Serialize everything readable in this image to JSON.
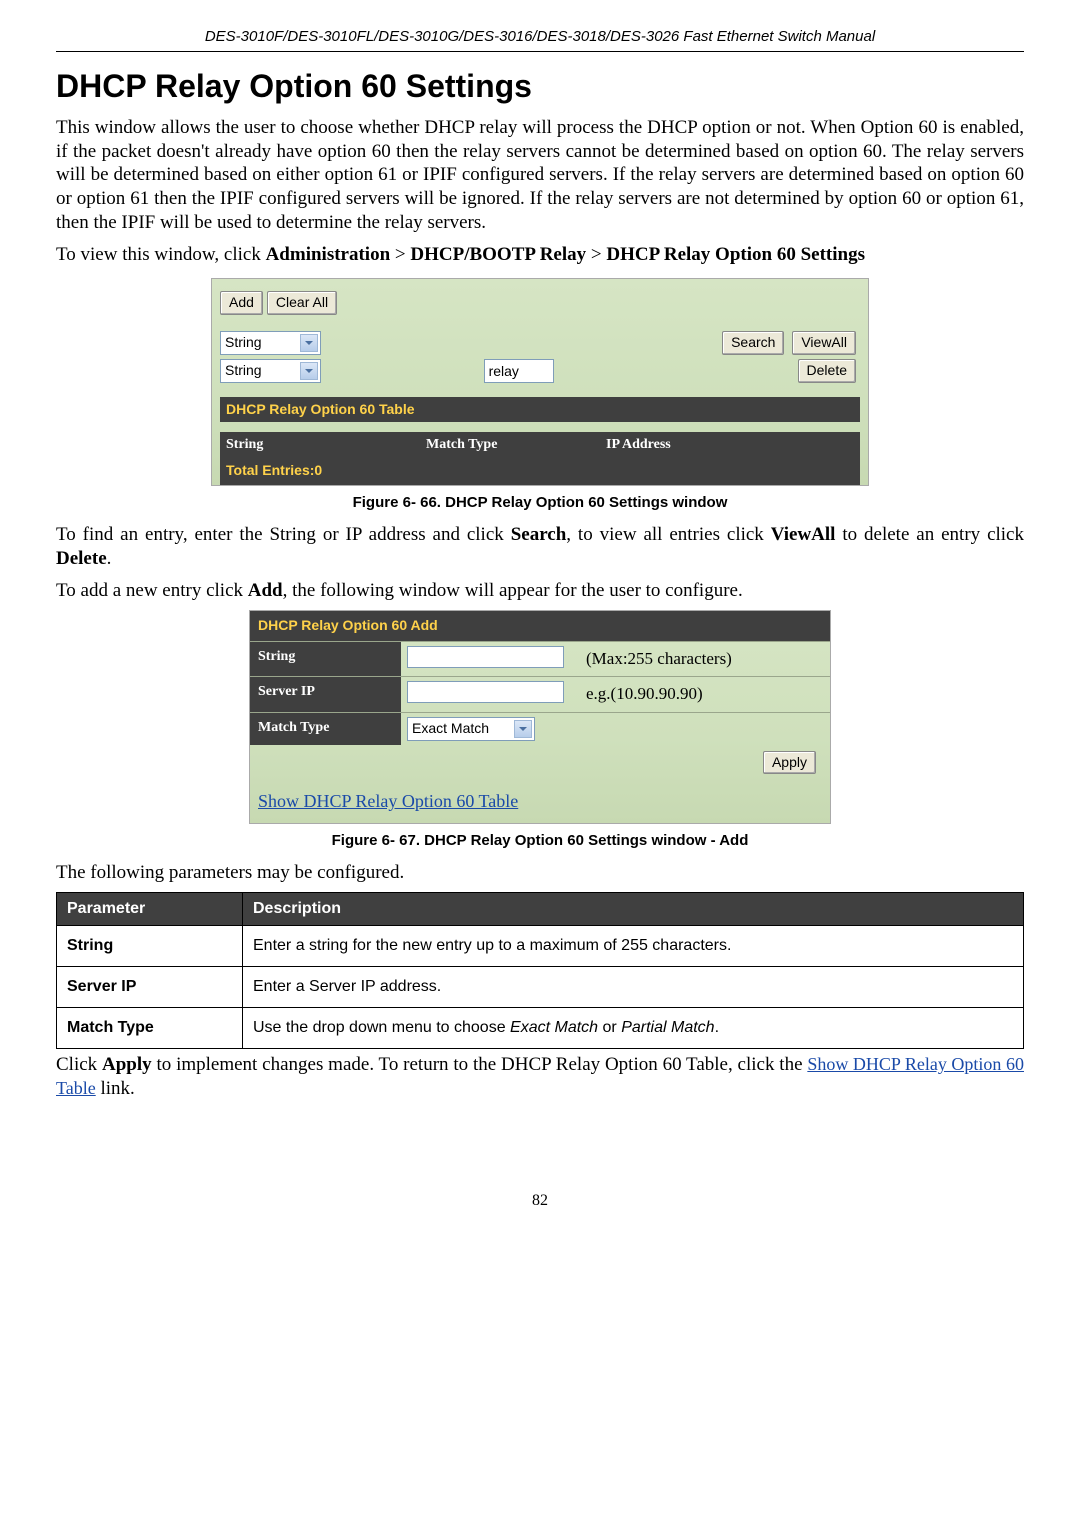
{
  "header": "DES-3010F/DES-3010FL/DES-3010G/DES-3016/DES-3018/DES-3026 Fast Ethernet Switch Manual",
  "title": "DHCP Relay Option 60 Settings",
  "para1": "This window allows the user to choose whether DHCP relay will process the DHCP option or not. When Option 60 is enabled, if the packet doesn't already have option 60 then the relay servers cannot be determined based on option 60.  The relay servers will be determined based on either option 61 or IPIF configured servers.  If the relay servers are determined based on option 60 or option 61 then the IPIF configured servers will be ignored. If the relay servers are not determined by option 60 or option 61, then the IPIF will be used to determine the relay servers.",
  "nav_intro": "To view this window, click ",
  "nav_path": {
    "a": "Administration",
    "b": "DHCP/BOOTP Relay",
    "c": "DHCP Relay Option 60 Settings"
  },
  "shot1": {
    "add_btn": "Add",
    "clear_btn": "Clear All",
    "select1": "String",
    "select2": "String",
    "textbox2_value": "relay",
    "search_btn": "Search",
    "viewall_btn": "ViewAll",
    "delete_btn": "Delete",
    "table_title": "DHCP Relay Option 60 Table",
    "col1": "String",
    "col2": "Match Type",
    "col3": "IP Address",
    "total": "Total Entries:0"
  },
  "caption1": "Figure 6- 66. DHCP Relay Option 60 Settings window",
  "para2_a": "To find an entry, enter the String or IP address and click ",
  "para2_b": "Search",
  "para2_c": ", to view all entries click ",
  "para2_d": "ViewAll",
  "para2_e": " to delete an entry click ",
  "para2_f": "Delete",
  "para2_g": ".",
  "para3_a": "To add a new entry click ",
  "para3_b": "Add",
  "para3_c": ", the following window will appear for the user to configure.",
  "shot2": {
    "title": "DHCP Relay Option 60 Add",
    "row1_label": "String",
    "row1_hint": "(Max:255 characters)",
    "row2_label": "Server IP",
    "row2_hint": "e.g.(10.90.90.90)",
    "row3_label": "Match Type",
    "row3_select": "Exact Match",
    "apply_btn": "Apply",
    "link": "Show DHCP Relay Option 60 Table"
  },
  "caption2": "Figure 6- 67. DHCP Relay Option 60 Settings window - Add",
  "para4": "The following parameters may be configured.",
  "paramTable": {
    "h1": "Parameter",
    "h2": "Description",
    "rows": [
      {
        "param": "String",
        "desc": "Enter a string for the new entry up to a maximum of 255 characters."
      },
      {
        "param": "Server IP",
        "desc": "Enter a Server IP address."
      },
      {
        "param": "Match Type",
        "desc_a": "Use the drop down menu to choose ",
        "desc_i1": "Exact Match",
        "desc_b": " or ",
        "desc_i2": "Partial Match",
        "desc_c": "."
      }
    ]
  },
  "para5_a": "Click ",
  "para5_b": "Apply",
  "para5_c": " to implement changes made. To return to the DHCP Relay Option 60 Table, click the ",
  "para5_link": "Show DHCP Relay Option 60 Table",
  "para5_d": " link.",
  "page_number": "82"
}
